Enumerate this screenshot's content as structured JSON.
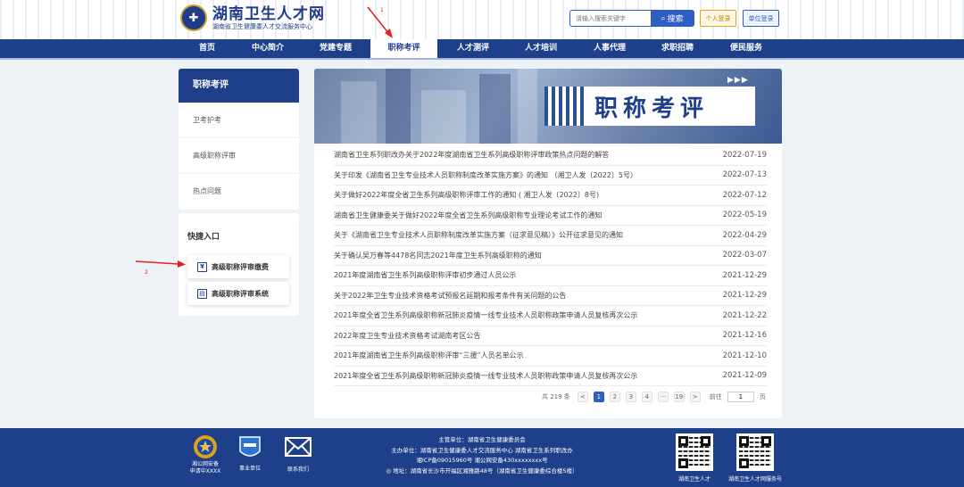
{
  "header": {
    "logo_title": "湖南卫生人才网",
    "logo_subtitle": "湖南省卫生健康委人才交流服务中心",
    "search_placeholder": "请输入搜索关键字",
    "search_button": "搜索",
    "personal_login": "个人登录",
    "unit_login": "单位登录"
  },
  "nav": {
    "items": [
      "首页",
      "中心简介",
      "党建专题",
      "职称考评",
      "人才测评",
      "人才培训",
      "人事代理",
      "求职招聘",
      "便民服务"
    ],
    "active": "职称考评"
  },
  "sidebar": {
    "title": "职称考评",
    "items": [
      "卫考护考",
      "高级职称评审",
      "热点问题"
    ]
  },
  "quick_entry": {
    "title": "快捷入口",
    "buttons": [
      {
        "label": "高级职称评审缴费",
        "icon": "yen-icon"
      },
      {
        "label": "高级职称评审系统",
        "icon": "monitor-icon"
      }
    ]
  },
  "banner": {
    "title": "职称考评",
    "arrows": "▶▶▶"
  },
  "news": [
    {
      "title": "湖南省卫生系列职改办关于2022年度湖南省卫生系列高级职称评审政策热点问题的解答",
      "date": "2022-07-19"
    },
    {
      "title": "关于印发《湖南省卫生专业技术人员职称制度改革实施方案》的通知 （湘卫人发〔2022〕5号）",
      "date": "2022-07-13"
    },
    {
      "title": "关于做好2022年度全省卫生系列高级职称评审工作的通知 ( 湘卫人发〔2022〕8号)",
      "date": "2022-07-12"
    },
    {
      "title": "湖南省卫生健康委关于做好2022年度全省卫生系列高级职称专业理论考试工作的通知",
      "date": "2022-05-19"
    },
    {
      "title": "关于《湖南省卫生专业技术人员职称制度改革实施方案（征求意见稿）》公开征求意见的通知",
      "date": "2022-04-29"
    },
    {
      "title": "关于确认吴万春等4478名同志2021年度卫生系列高级职称的通知",
      "date": "2022-03-07"
    },
    {
      "title": "2021年度湖南省卫生系列高级职称评审初步通过人员公示",
      "date": "2021-12-29"
    },
    {
      "title": "关于2022年卫生专业技术资格考试预报名延期和报考条件有关问题的公告",
      "date": "2021-12-29"
    },
    {
      "title": "2021年度全省卫生系列高级职称新冠肺炎疫情一线专业技术人员职称政策申请人员复核再次公示",
      "date": "2021-12-22"
    },
    {
      "title": "2022年度卫生专业技术资格考试湖南考区公告",
      "date": "2021-12-16"
    },
    {
      "title": "2021年度湖南省卫生系列高级职称评审“三援”人员名单公示",
      "date": "2021-12-10"
    },
    {
      "title": "2021年度全省卫生系列高级职称新冠肺炎疫情一线专业技术人员职称政策申请人员复核再次公示",
      "date": "2021-12-09"
    }
  ],
  "pagination": {
    "total": "共 219 条",
    "prev": "<",
    "pages": [
      "1",
      "2",
      "3",
      "4",
      "···",
      "19"
    ],
    "next": ">",
    "goto_label": "前往",
    "goto_value": "1",
    "page_unit": "页"
  },
  "footer": {
    "icons": [
      {
        "label": "湘公网安备\n申请中XXXX",
        "icon": "police-badge-icon"
      },
      {
        "label": "事业单位",
        "icon": "institution-icon"
      },
      {
        "label": "联系我们",
        "icon": "mail-icon"
      }
    ],
    "lines": [
      "主管单位：湖南省卫生健康委员会",
      "主办单位：湖南省卫生健康委人才交流服务中心 湖南省卫生系列职改办",
      "湘ICP备09015960号 湘公网安备430xxxxxxxx号",
      "◎ 地址：湖南省长沙市开福区湘雅路48号（湖南省卫生健康委综合楼5楼）"
    ],
    "qr_labels": [
      "湖南卫生人才",
      "湖南卫生人才网服务号"
    ]
  },
  "annotations": {
    "arrow1_label": "1",
    "arrow2_label": "2",
    "color": "#e02020"
  }
}
